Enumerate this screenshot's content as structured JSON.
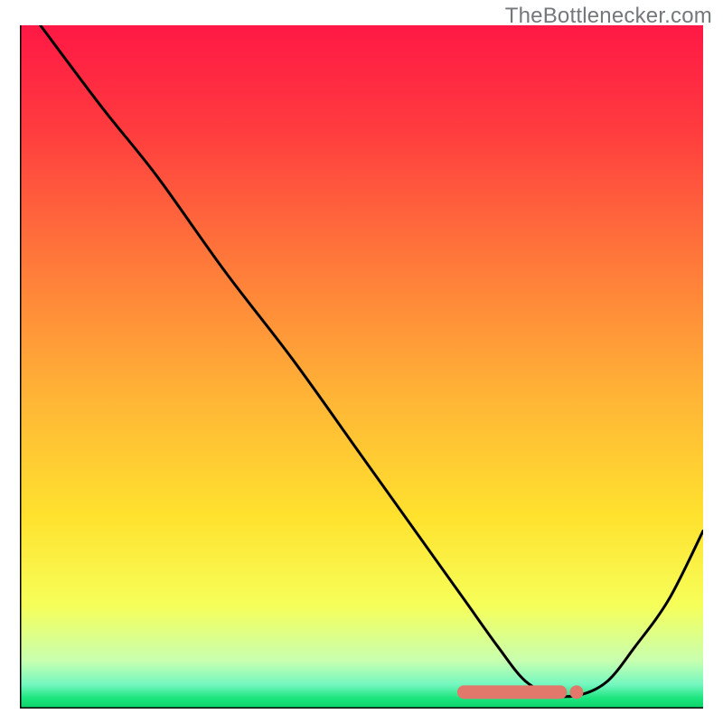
{
  "attribution": "TheBottlenecker.com",
  "chart_data": {
    "type": "line",
    "title": "",
    "xlabel": "",
    "ylabel": "",
    "xlim": [
      0,
      100
    ],
    "ylim": [
      0,
      100
    ],
    "series": [
      {
        "name": "curve",
        "x": [
          3,
          12,
          20,
          30,
          40,
          50,
          60,
          65,
          70,
          74,
          78,
          82,
          86,
          90,
          95,
          100
        ],
        "y": [
          100,
          88,
          78,
          64,
          51,
          37,
          23,
          16,
          9,
          4,
          2,
          2,
          4,
          9,
          16,
          26
        ]
      }
    ],
    "highlight_band": {
      "x0": 65,
      "x1": 82,
      "y": 2.4
    },
    "gradient_stops": [
      {
        "offset": 0.0,
        "color": "#ff1845"
      },
      {
        "offset": 0.15,
        "color": "#ff3b3f"
      },
      {
        "offset": 0.35,
        "color": "#ff7a3a"
      },
      {
        "offset": 0.55,
        "color": "#ffb636"
      },
      {
        "offset": 0.72,
        "color": "#ffe22e"
      },
      {
        "offset": 0.85,
        "color": "#f6ff5a"
      },
      {
        "offset": 0.93,
        "color": "#c8ffb0"
      },
      {
        "offset": 0.965,
        "color": "#73f7c0"
      },
      {
        "offset": 0.985,
        "color": "#1be57d"
      },
      {
        "offset": 1.0,
        "color": "#0bd168"
      }
    ]
  }
}
